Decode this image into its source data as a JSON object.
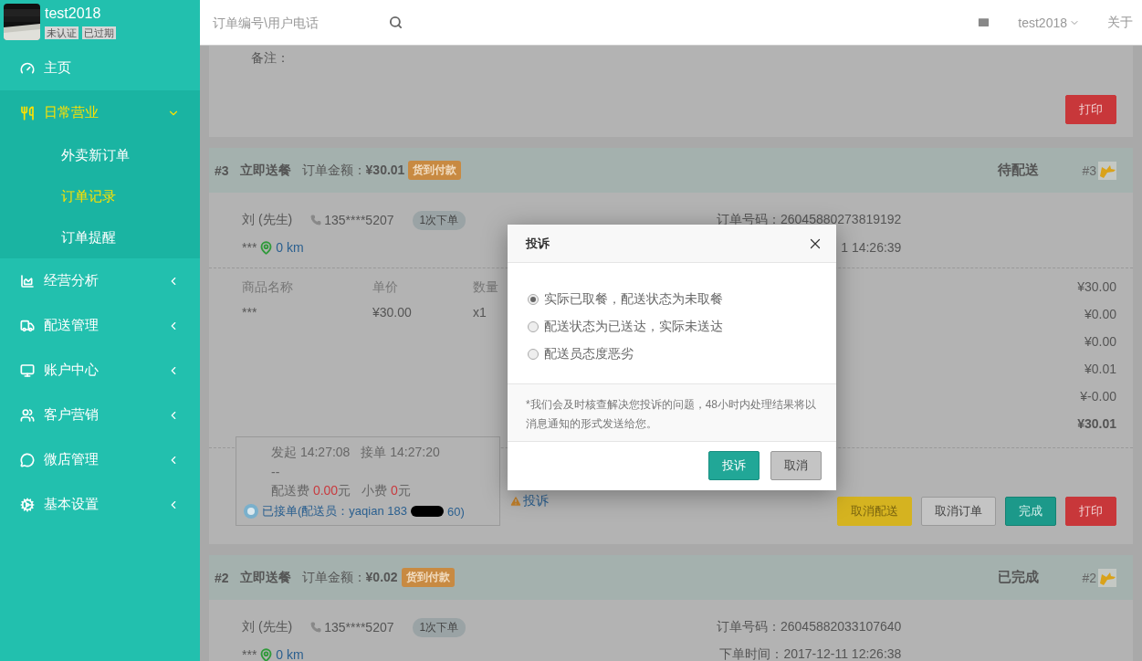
{
  "profile": {
    "name": "test2018",
    "badges": [
      "未认证",
      "已过期"
    ]
  },
  "header": {
    "search_placeholder": "订单编号\\用户电话",
    "user": "test2018",
    "about": "关于"
  },
  "sidebar": {
    "items": [
      {
        "label": "主页",
        "kind": "link",
        "selected": false
      },
      {
        "label": "日常营业",
        "kind": "group",
        "selected": true,
        "expanded": true,
        "children": [
          {
            "label": "外卖新订单",
            "selected": false
          },
          {
            "label": "订单记录",
            "selected": true
          },
          {
            "label": "订单提醒",
            "selected": false
          }
        ]
      },
      {
        "label": "经营分析",
        "kind": "group",
        "selected": false,
        "expanded": false
      },
      {
        "label": "配送管理",
        "kind": "group",
        "selected": false,
        "expanded": false
      },
      {
        "label": "账户中心",
        "kind": "group",
        "selected": false,
        "expanded": false
      },
      {
        "label": "客户营销",
        "kind": "group",
        "selected": false,
        "expanded": false
      },
      {
        "label": "微店管理",
        "kind": "group",
        "selected": false,
        "expanded": false
      },
      {
        "label": "基本设置",
        "kind": "group",
        "selected": false,
        "expanded": false
      }
    ]
  },
  "partial_order": {
    "note_label": "备注：",
    "buttons": [
      {
        "label": "打印",
        "kind": "danger"
      }
    ]
  },
  "orders": [
    {
      "number": "#3",
      "type": "立即送餐",
      "amount_label": "订单金额：",
      "amount": "¥30.01",
      "pay_tag": "货到付款",
      "status": "待配送",
      "seq": "#3",
      "customer": "刘 (先生)",
      "phone": "135****5207",
      "order_count": "1次下单",
      "address": "***",
      "distance": "0 km",
      "order_no": "订单号码：26045880273819192",
      "order_time": "1 14:26:39",
      "item_columns": [
        "商品名称",
        "单价",
        "数量"
      ],
      "items": [
        [
          "***",
          "¥30.00",
          "x1"
        ]
      ],
      "fees": [
        {
          "value": "¥30.00",
          "bold": false
        },
        {
          "value": "¥0.00",
          "bold": false
        },
        {
          "value": "¥0.00",
          "bold": false
        },
        {
          "value": "¥0.01",
          "bold": false
        },
        {
          "value": "¥-0.00",
          "bold": false
        },
        {
          "value": "¥30.01",
          "bold": true
        }
      ],
      "delivery": {
        "start": "发起 14:27:08",
        "accept": "接单 14:27:20",
        "dash": "--",
        "fee_label": "配送费",
        "fee": "0.00",
        "fee_unit": "元",
        "tip_label": "小费",
        "tip": "0",
        "tip_unit": "元",
        "status_pre": "已接单(配送员：yaqian 183",
        "status_post": "60)",
        "complain": "投诉"
      },
      "buttons": [
        {
          "label": "取消配送",
          "kind": "warning"
        },
        {
          "label": "取消订单",
          "kind": "default"
        },
        {
          "label": "完成",
          "kind": "success"
        },
        {
          "label": "打印",
          "kind": "danger"
        }
      ]
    },
    {
      "number": "#2",
      "type": "立即送餐",
      "amount_label": "订单金额：",
      "amount": "¥0.02",
      "pay_tag": "货到付款",
      "status": "已完成",
      "seq": "#2",
      "customer": "刘 (先生)",
      "phone": "135****5207",
      "order_count": "1次下单",
      "address": "***",
      "distance": "0 km",
      "order_no": "订单号码：26045882033107640",
      "order_time": "下单时间：2017-12-11 12:26:38"
    }
  ],
  "modal": {
    "title": "投诉",
    "options": [
      {
        "label": "实际已取餐，配送状态为未取餐",
        "selected": true
      },
      {
        "label": "配送状态为已送达，实际未送达",
        "selected": false
      },
      {
        "label": "配送员态度恶劣",
        "selected": false
      }
    ],
    "note": "*我们会及时核查解决您投诉的问题，48小时内处理结果将以消息通知的形式发送给您。",
    "buttons": [
      {
        "label": "投诉",
        "kind": "primary"
      },
      {
        "label": "取消",
        "kind": "default"
      }
    ]
  }
}
